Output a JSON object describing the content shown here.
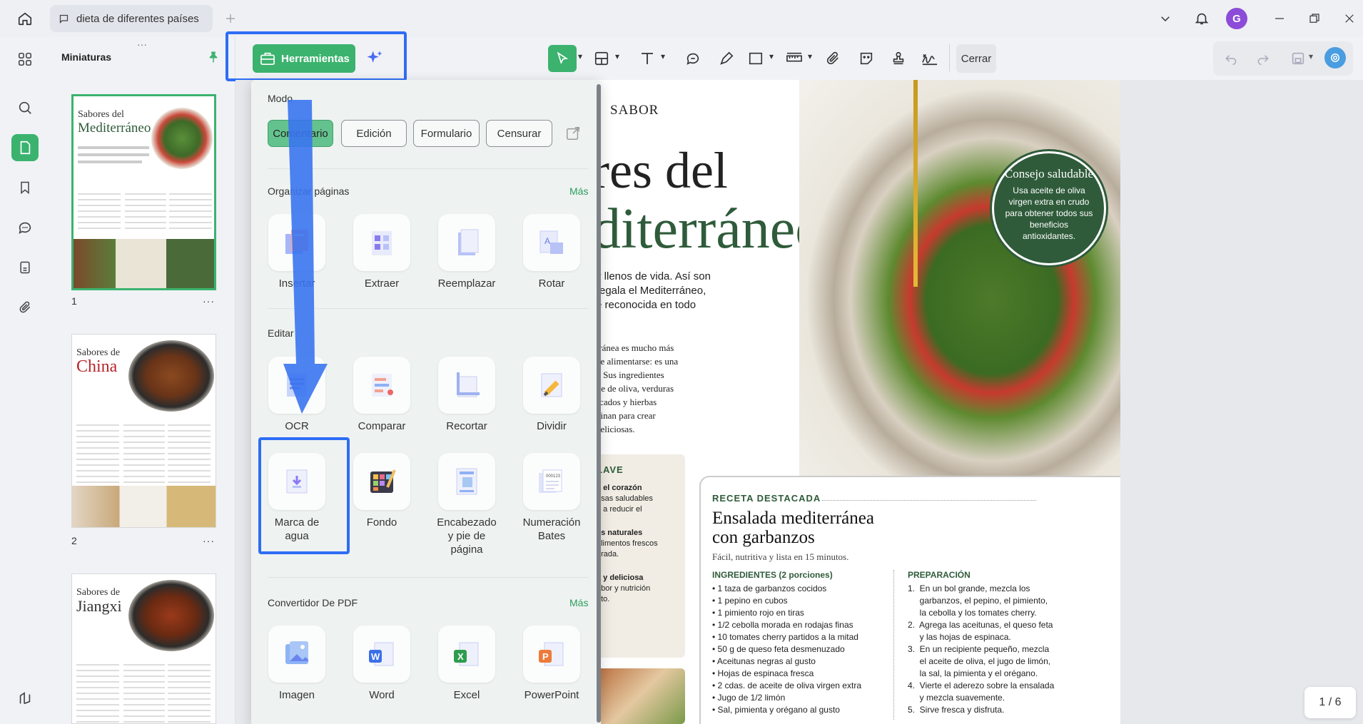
{
  "window": {
    "tab_title": "dieta de diferentes países",
    "avatar_letter": "G"
  },
  "thumbnails": {
    "title": "Miniaturas",
    "pages": [
      {
        "num": "1",
        "header": "Sabores del",
        "title": "Mediterráneo"
      },
      {
        "num": "2",
        "header": "Sabores de",
        "title": "China"
      },
      {
        "num": "",
        "header": "Sabores de",
        "title": "Jiangxi"
      }
    ],
    "more_label": "···"
  },
  "toolbar": {
    "tools_label": "Herramientas",
    "close_label": "Cerrar"
  },
  "menu": {
    "mode_title": "Modo",
    "modes": [
      "Comentario",
      "Edición",
      "Formulario",
      "Censurar"
    ],
    "organize_title": "Organizar páginas",
    "organize_more": "Más",
    "organize_tools": [
      "Insertar",
      "Extraer",
      "Reemplazar",
      "Rotar"
    ],
    "edit_title": "Editar",
    "edit_tools": [
      "OCR",
      "Comparar",
      "Recortar",
      "Dividir"
    ],
    "edit_tools2": [
      "Marca de agua",
      "Fondo",
      "Encabezado y pie de página",
      "Numeración Bates"
    ],
    "convert_title": "Convertidor De PDF",
    "convert_more": "Más",
    "convert_tools": [
      "Imagen",
      "Word",
      "Excel",
      "PowerPoint"
    ]
  },
  "document": {
    "kicker": "SABOR",
    "title_line1": "res del",
    "title_line2": "diterráneo",
    "intro": [
      "y llenos de vida. Así son",
      "regala el Mediterráneo,",
      "e reconocida en todo"
    ],
    "body": [
      "rránea es mucho más",
      "de alimentarse: es una",
      "l. Sus ingredientes",
      "ite de oliva, verduras",
      "scados y hierbas",
      "binan para crear",
      "deliciosas."
    ],
    "tip_title": "Consejo saludable",
    "tip_text": "Usa aceite de oliva virgen extra en crudo para obtener todos sus beneficios antioxidantes.",
    "side_heading": "LAVE",
    "side_items": [
      "a el corazón",
      "asas saludables",
      "n a reducir el",
      "es naturales",
      "alimentos frescos",
      "orada.",
      "a y deliciosa",
      "abor y nutrición",
      "ato."
    ],
    "recipe_kicker": "RECETA DESTACADA",
    "recipe_title1": "Ensalada mediterránea",
    "recipe_title2": "con garbanzos",
    "recipe_sub": "Fácil, nutritiva y lista en 15 minutos.",
    "ingredients_title": "INGREDIENTES (2 porciones)",
    "ingredients": [
      "1 taza de garbanzos cocidos",
      "1 pepino en cubos",
      "1 pimiento rojo en tiras",
      "1/2 cebolla morada en rodajas finas",
      "10 tomates cherry partidos a la mitad",
      "50 g de queso feta desmenuzado",
      "Aceitunas negras al gusto",
      "Hojas de espinaca fresca",
      "2 cdas. de aceite de oliva virgen extra",
      "Jugo de 1/2 limón",
      "Sal, pimienta y orégano al gusto"
    ],
    "prep_title": "PREPARACIÓN",
    "prep": [
      "1.  En un bol grande, mezcla los",
      "     garbanzos, el pepino, el pimiento,",
      "     la cebolla y los tomates cherry.",
      "2.  Agrega las aceitunas, el queso feta",
      "     y las hojas de espinaca.",
      "3.  En un recipiente pequeño, mezcla",
      "     el aceite de oliva, el jugo de limón,",
      "     la sal, la pimienta y el orégano.",
      "4.  Vierte el aderezo sobre la ensalada",
      "     y mezcla suavemente.",
      "5.  Sirve fresca y disfruta."
    ],
    "page_indicator": "1 / 6"
  },
  "colors": {
    "accent_green": "#3bb36e",
    "highlight_blue": "#2f6df6",
    "doc_green": "#2f5b3a"
  }
}
